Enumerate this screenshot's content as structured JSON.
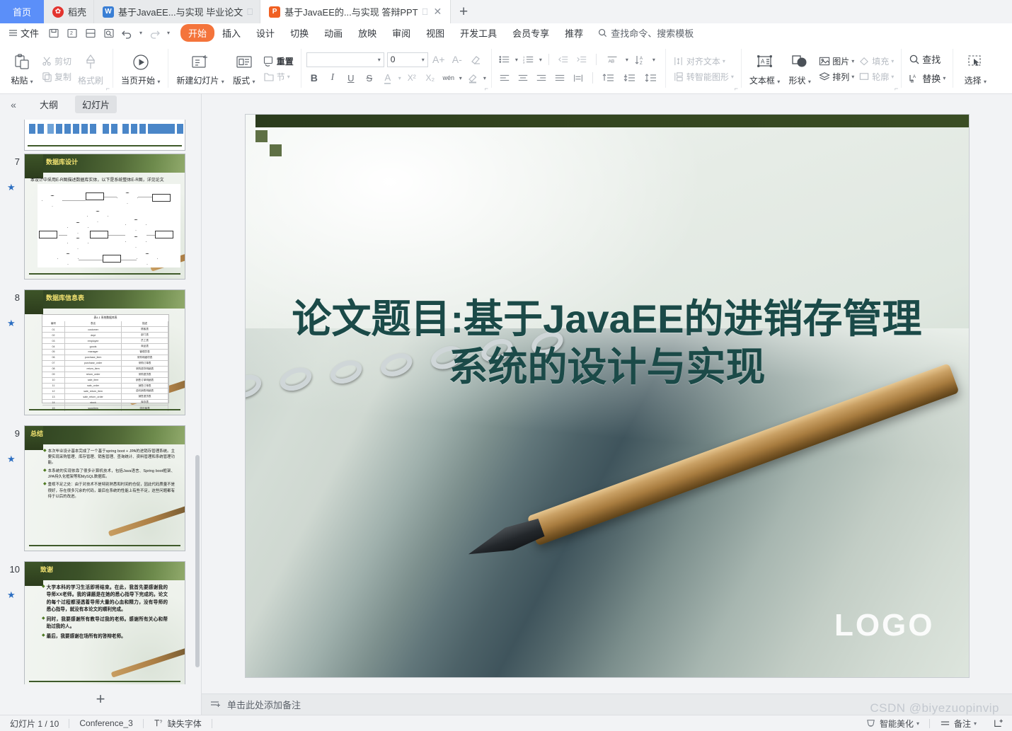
{
  "window": {
    "home_tab": "首页",
    "tabs": [
      {
        "label": "稻壳",
        "icon": "flower-icon",
        "active": false,
        "has_close": false
      },
      {
        "label": "基于JavaEE...与实现 毕业论文",
        "icon": "wps-writer-icon",
        "active": false,
        "has_close": false
      },
      {
        "label": "基于JavaEE的...与实现 答辩PPT",
        "icon": "wps-presentation-icon",
        "active": true,
        "has_close": true
      }
    ],
    "new_tab_label": "+"
  },
  "menubar": {
    "file_label": "文件",
    "quick_icons": [
      "save-icon",
      "save-as-icon",
      "print-icon",
      "print-preview-icon",
      "undo-icon",
      "redo-icon",
      "customize-icon"
    ],
    "tabs": [
      "开始",
      "插入",
      "设计",
      "切换",
      "动画",
      "放映",
      "审阅",
      "视图",
      "开发工具",
      "会员专享",
      "推荐"
    ],
    "selected_tab": "开始",
    "accent_color": "#f4743b",
    "search_placeholder": "查找命令、搜索模板"
  },
  "ribbon": {
    "clipboard": {
      "paste": "粘贴",
      "cut": "剪切",
      "copy": "复制",
      "format_painter": "格式刷"
    },
    "present": {
      "from_current": "当页开始"
    },
    "slides": {
      "new_slide": "新建幻灯片",
      "layout": "版式",
      "reset": "重置",
      "section": "节"
    },
    "font": {
      "name_value": "",
      "size_value": "0",
      "grow": "A+",
      "shrink": "A-",
      "clear_format": "clear-format-icon",
      "bold": "B",
      "italic": "I",
      "underline": "U",
      "strikethrough": "S",
      "font_color": "A",
      "superscript": "X²",
      "subscript": "X₂",
      "phonetic": "wén",
      "highlight": "highlight-icon"
    },
    "paragraph": {
      "bullets": "bullet-list-icon",
      "numbering": "numbered-list-icon",
      "decrease_indent": "decrease-indent-icon",
      "increase_indent": "increase-indent-icon",
      "text_direction": "text-direction-icon",
      "sort": "sort-icon",
      "align_left": "align-left-icon",
      "align_center": "align-center-icon",
      "align_right": "align-right-icon",
      "justify": "justify-icon",
      "distribute": "distribute-icon",
      "line_spacing": "line-spacing-icon",
      "space_before": "space-before-icon",
      "space_after": "space-after-icon"
    },
    "textgroup": {
      "align_text": "对齐文本",
      "convert_smartart": "转智能图形"
    },
    "insert": {
      "textbox": "文本框",
      "shape": "形状",
      "picture": "图片",
      "arrange": "排列",
      "fill": "填充",
      "outline": "轮廓"
    },
    "editing": {
      "find": "查找",
      "replace": "替换",
      "select": "选择"
    }
  },
  "slide_panel": {
    "collapse_icon": "chevron-double-left-icon",
    "tabs": [
      {
        "label": "大纲",
        "active": false
      },
      {
        "label": "幻灯片",
        "active": true
      }
    ],
    "add_slide_label": "+",
    "slides": [
      {
        "number": "6",
        "partial": true,
        "title": "",
        "type": "diagram-boxes"
      },
      {
        "number": "7",
        "title": "数据库设计",
        "type": "er-diagram",
        "intro": "本设计中采用E-R图描述数据库实体，以下是系统整体E-R图，详见论文"
      },
      {
        "number": "8",
        "title": "数据库信息表",
        "type": "table",
        "table_caption": "表4-1 系统数据库表",
        "table_headers": [
          "编号",
          "表名",
          "描述"
        ],
        "table_rows": [
          [
            "01",
            "customer",
            "顾客表"
          ],
          [
            "02",
            "dept",
            "部门表"
          ],
          [
            "03",
            "employee",
            "员工表"
          ],
          [
            "04",
            "goods",
            "商品表"
          ],
          [
            "05",
            "manager",
            "管理员表"
          ],
          [
            "06",
            "purchase_item",
            "采购明细项表"
          ],
          [
            "07",
            "purchase_order",
            "采购订单表"
          ],
          [
            "08",
            "return_item",
            "采购退货明细表"
          ],
          [
            "09",
            "return_order",
            "采购退货表"
          ],
          [
            "10",
            "sale_item",
            "销售订单明细表"
          ],
          [
            "11",
            "sale_order",
            "销售订单表"
          ],
          [
            "12",
            "sale_return_item",
            "逆向销售明细表"
          ],
          [
            "13",
            "sale_return_order",
            "销售退货表"
          ],
          [
            "14",
            "stock",
            "库存表"
          ],
          [
            "15",
            "suppliers",
            "供应商表"
          ]
        ]
      },
      {
        "number": "9",
        "title": "总结",
        "type": "bullets",
        "bullets": [
          "本次毕业设计基本完成了一个基于spring boot + JPA的进销存管理系统。主要实现采购管理、库存管理、销售管理、查询统计、资料管理和系统管理功能。",
          "本系统的实现依靠了很多计算机技术，包括Java语言、Spring boot框架、JPA持久化框架等和MySQL数据库。",
          "重视不足之处：由于对技术不是特别熟悉和时间的仓促，因此代码质量不是很好，存在很多冗余的代码，最后在系统的性能上有些不足，这些问题都有待于以后的改进。"
        ]
      },
      {
        "number": "10",
        "title": "致谢",
        "type": "bullets-large",
        "bullets": [
          "大学本科的学习生活即将结束。在此，我首先要感谢我的导师XX老师。我的课题是在她的悉心指导下完成的。论文的每个过程都浸透着导师大量的心血和精力，没有导师的悉心指导，就没有本论文的顺利完成。",
          "同时，我要感谢所有教导过我的老师。感谢所有关心和帮助过我的人。",
          "最后，我要感谢在场所有的答辩老师。"
        ]
      }
    ]
  },
  "main_slide": {
    "title": "论文题目:基于JavaEE的进销存管理系统的设计与实现",
    "logo": "LOGO",
    "title_color": "#1b4a48"
  },
  "notes": {
    "icon": "notes-icon",
    "placeholder": "单击此处添加备注"
  },
  "statusbar": {
    "slide_counter": "幻灯片 1 / 10",
    "theme_name": "Conference_3",
    "missing_font_icon": "missing-font-icon",
    "missing_font": "缺失字体",
    "beautify_icon": "beautify-icon",
    "beautify": "智能美化",
    "notes_toggle_icon": "notes-toggle-icon",
    "notes_toggle": "备注",
    "fit_icon": "fit-to-window-icon"
  },
  "watermark": "CSDN @biyezuopinvip"
}
